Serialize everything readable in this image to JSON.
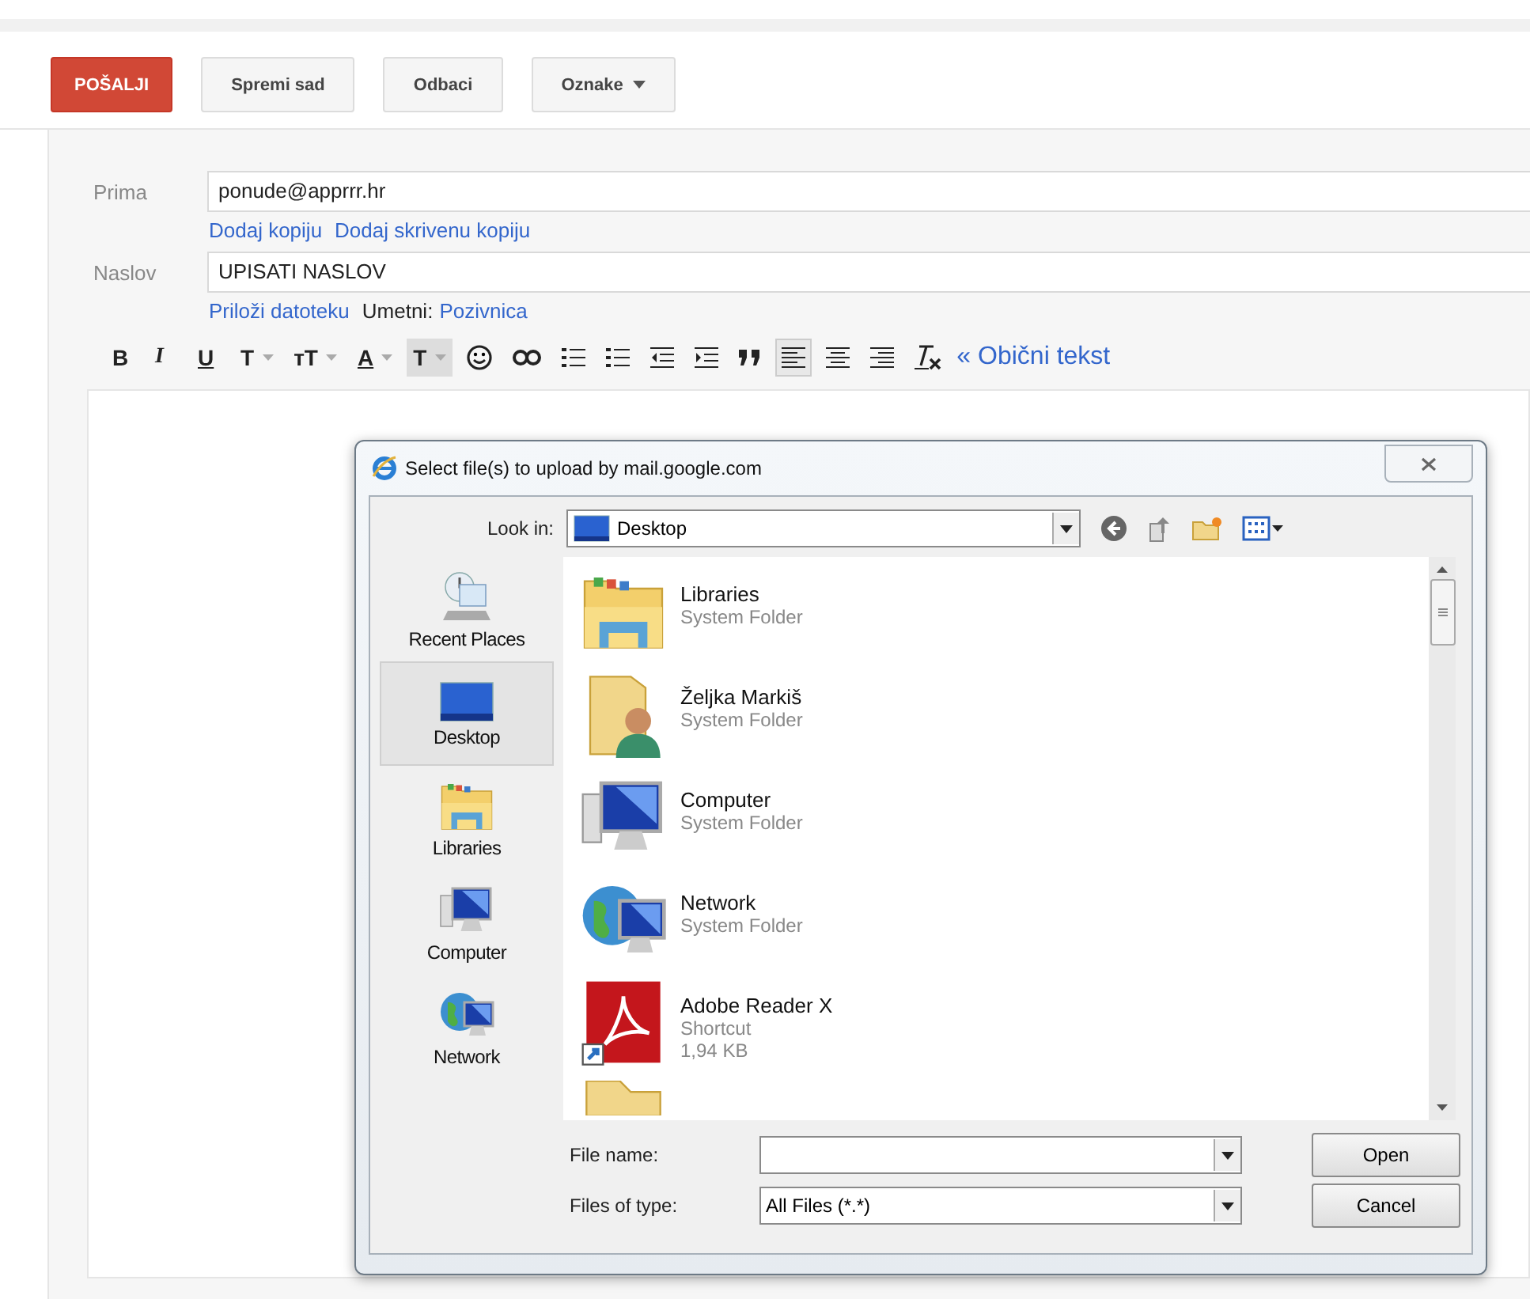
{
  "actions": [
    {
      "label": "POŠALJI",
      "kind": "primary"
    },
    {
      "label": "Spremi sad",
      "kind": "plain"
    },
    {
      "label": "Odbaci",
      "kind": "plain"
    },
    {
      "label": "Oznake",
      "kind": "menu"
    }
  ],
  "compose": {
    "to_label": "Prima",
    "to_value": "ponude@apprrr.hr",
    "cc_links": [
      "Dodaj kopiju",
      "Dodaj skrivenu kopiju"
    ],
    "subject_label": "Naslov",
    "subject_value": "UPISATI NASLOV",
    "attach_link": "Priloži datoteku",
    "insert_label": "Umetni:",
    "insert_link": "Pozivnica"
  },
  "format_tools": [
    {
      "kind": "bold",
      "label": "B",
      "selected": false
    },
    {
      "kind": "italic",
      "label": "I",
      "selected": false
    },
    {
      "kind": "underline",
      "label": "U",
      "selected": false
    },
    {
      "kind": "font",
      "label": "T",
      "selected": false
    },
    {
      "kind": "size",
      "label": "тT",
      "selected": false
    },
    {
      "kind": "text-color",
      "label": "A",
      "selected": false
    },
    {
      "kind": "highlight",
      "label": "T",
      "selected": false
    },
    {
      "kind": "emoji",
      "selected": false
    },
    {
      "kind": "link",
      "selected": false
    },
    {
      "kind": "numbered-list",
      "selected": false
    },
    {
      "kind": "bulleted-list",
      "selected": false
    },
    {
      "kind": "indent-less",
      "selected": false
    },
    {
      "kind": "indent-more",
      "selected": false
    },
    {
      "kind": "quote",
      "selected": false
    },
    {
      "kind": "align-left",
      "selected": true
    },
    {
      "kind": "align-center",
      "selected": false
    },
    {
      "kind": "align-right",
      "selected": false
    },
    {
      "kind": "clear-format",
      "selected": false
    }
  ],
  "plain_text_link": "« Obični tekst",
  "dialog": {
    "title": "Select file(s) to upload by mail.google.com",
    "look_in_label": "Look in:",
    "look_in_value": "Desktop",
    "places": [
      {
        "label": "Recent Places",
        "kind": "recent",
        "selected": false
      },
      {
        "label": "Desktop",
        "kind": "desktop",
        "selected": true
      },
      {
        "label": "Libraries",
        "kind": "libraries",
        "selected": false
      },
      {
        "label": "Computer",
        "kind": "computer",
        "selected": false
      },
      {
        "label": "Network",
        "kind": "network",
        "selected": false
      }
    ],
    "files": [
      {
        "name": "Libraries",
        "type": "System Folder",
        "kind": "libraries"
      },
      {
        "name": "Željka Markiš",
        "type": "System Folder",
        "kind": "user"
      },
      {
        "name": "Computer",
        "type": "System Folder",
        "kind": "computer"
      },
      {
        "name": "Network",
        "type": "System Folder",
        "kind": "network"
      },
      {
        "name": "Adobe Reader X",
        "type": "Shortcut",
        "size": "1,94 KB",
        "kind": "pdf-shortcut"
      },
      {
        "kind": "folder"
      }
    ],
    "file_name_label": "File name:",
    "file_type_label": "Files of type:",
    "file_type_value": "All Files (*.*)",
    "open_button": "Open",
    "cancel_button": "Cancel"
  }
}
